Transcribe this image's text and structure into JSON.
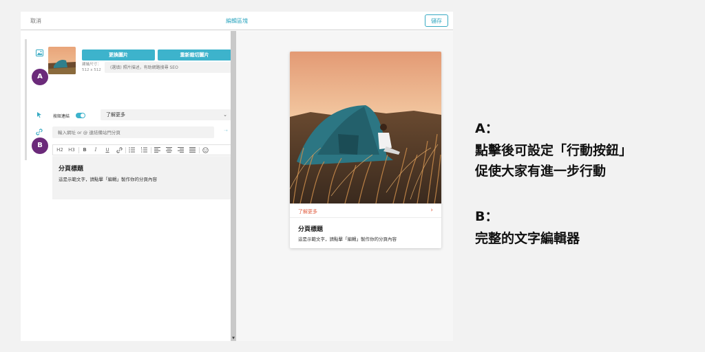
{
  "topbar": {
    "cancel_label": "取消",
    "title": "編輯區塊",
    "save_label": "儲存"
  },
  "editor": {
    "replace_image_label": "更換圖片",
    "recrop_image_label": "重新裁切圖片",
    "size_label_line1": "建議尺寸：",
    "size_label_line2": "512 x 512",
    "alt_placeholder": "(選填) 照片描述，有助網路搜尋 SEO",
    "cta_label": "按鈕連結",
    "cta_enabled": true,
    "cta_select_value": "了解更多",
    "url_placeholder": "輸入網址 or @ 連結備站門分頁",
    "toolbar": {
      "h2": "H2",
      "h3": "H3",
      "bold": "B",
      "italic": "I",
      "underline": "U"
    },
    "text_heading": "分頁標題",
    "text_body": "這是示範文字，請點擊「編輯」製作你的分頁內容"
  },
  "badges": {
    "a": "A",
    "b": "B"
  },
  "preview": {
    "link_text": "了解更多",
    "title": "分頁標題",
    "body": "這是示範文字，請點擊「編輯」製作你的分頁內容"
  },
  "notes": {
    "a_heading": "A：",
    "a_line1": "點擊後可設定「行動按鈕」",
    "a_line2": "促使大家有進一步行動",
    "b_heading": "B：",
    "b_line1": "完整的文字編輯器"
  },
  "colors": {
    "accent": "#3db3cc",
    "badge": "#6b2a7a",
    "link": "#e05a3c"
  }
}
